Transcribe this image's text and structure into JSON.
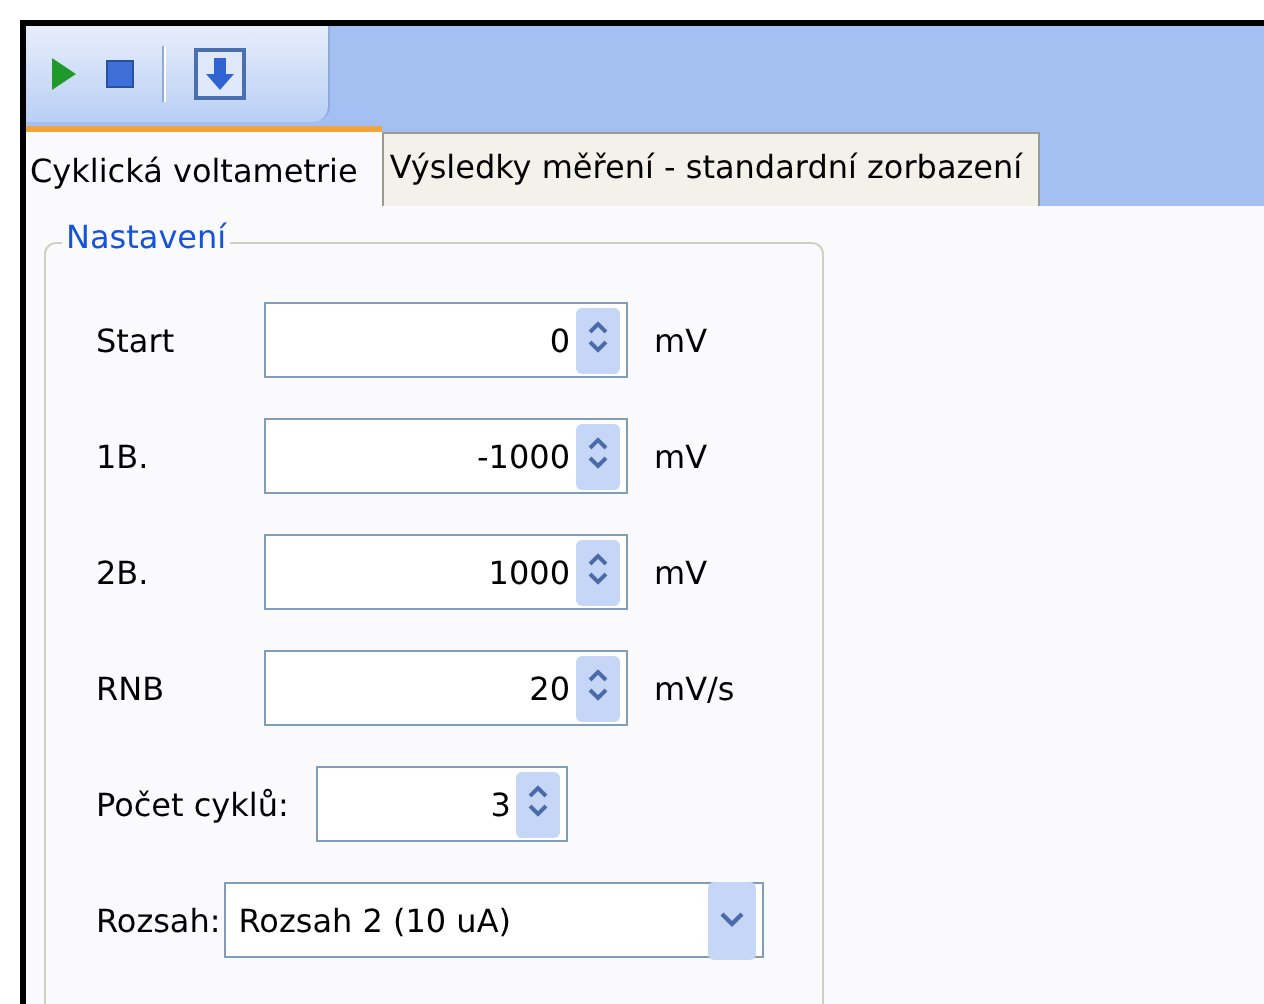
{
  "toolbar": {
    "buttons": [
      {
        "kind": "play"
      },
      {
        "kind": "stop"
      },
      {
        "kind": "separator"
      },
      {
        "kind": "download"
      }
    ]
  },
  "tabs": [
    {
      "label": "Cyklická voltametrie",
      "selected": true
    },
    {
      "label": "Výsledky měření - standardní zorbazení",
      "selected": false
    }
  ],
  "group": {
    "title": "Nastavení",
    "rows": [
      {
        "kind": "spin",
        "label": "Start",
        "value": "0",
        "unit": "mV"
      },
      {
        "kind": "spin",
        "label": "1B.",
        "value": "-1000",
        "unit": "mV"
      },
      {
        "kind": "spin",
        "label": "2B.",
        "value": "1000",
        "unit": "mV"
      },
      {
        "kind": "spin",
        "label": "RNB",
        "value": "20",
        "unit": "mV/s"
      },
      {
        "kind": "spin-short",
        "label": "Počet cyklů:",
        "value": "3"
      },
      {
        "kind": "combo",
        "label": "Rozsah:",
        "value": "Rozsah 2 (10 uA)"
      }
    ]
  }
}
